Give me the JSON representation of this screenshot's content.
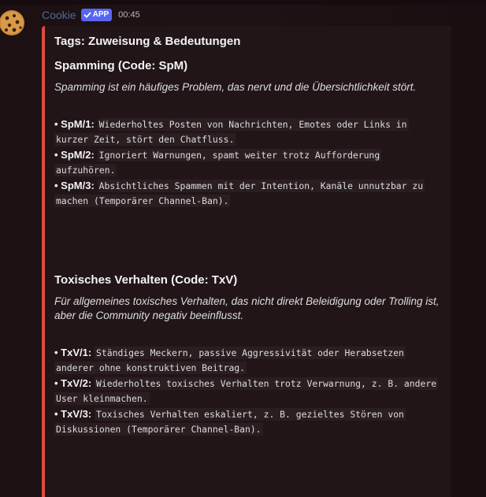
{
  "message": {
    "username": "Cookie",
    "badge": "APP",
    "timestamp": "00:45",
    "avatar_icon": "cookie-icon"
  },
  "embed": {
    "accent_color": "#e04a3f",
    "title": "Tags: Zuweisung & Bedeutungen",
    "sections": [
      {
        "title": "Spamming (Code: SpM)",
        "description": "Spamming ist ein häufiges Problem, das nervt und die Übersichtlichkeit stört.",
        "rules": [
          {
            "code": "SpM/1:",
            "text": "Wiederholtes Posten von Nachrichten, Emotes oder Links in kurzer Zeit, stört den Chatfluss."
          },
          {
            "code": "SpM/2:",
            "text": "Ignoriert Warnungen, spamt weiter trotz Aufforderung aufzuhören."
          },
          {
            "code": "SpM/3:",
            "text": "Absichtliches Spammen mit der Intention, Kanäle unnutzbar zu machen (Temporärer Channel-Ban)."
          }
        ]
      },
      {
        "title": "Toxisches Verhalten (Code: TxV)",
        "description": "Für allgemeines toxisches Verhalten, das nicht direkt Beleidigung oder Trolling ist, aber die Community negativ beeinflusst.",
        "rules": [
          {
            "code": "TxV/1:",
            "text": "Ständiges Meckern, passive Aggressivität oder Herabsetzen anderer ohne konstruktiven Beitrag."
          },
          {
            "code": "TxV/2:",
            "text": "Wiederholtes toxisches Verhalten trotz Verwarnung, z. B. andere User kleinmachen."
          },
          {
            "code": "TxV/3:",
            "text": "Toxisches Verhalten eskaliert, z. B. gezieltes Stören von Diskussionen (Temporärer Channel-Ban)."
          }
        ]
      }
    ]
  }
}
